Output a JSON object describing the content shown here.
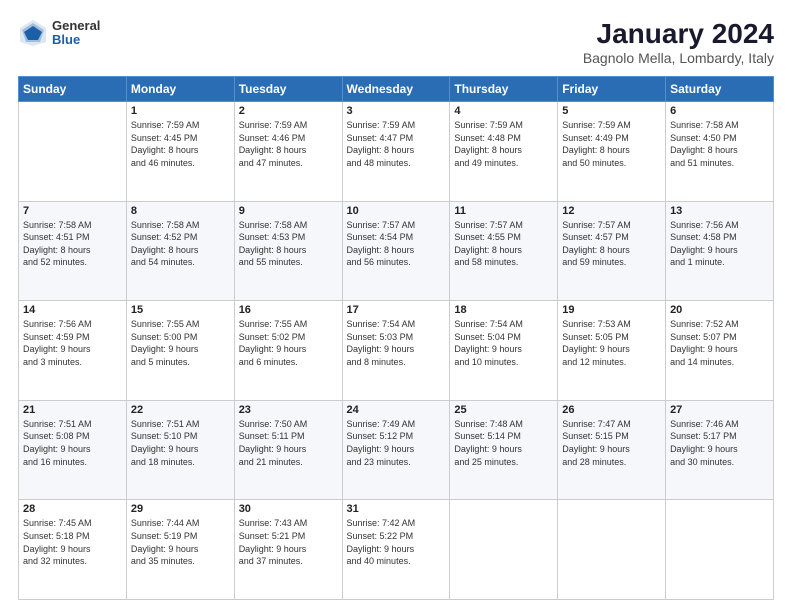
{
  "header": {
    "logo": {
      "general": "General",
      "blue": "Blue"
    },
    "title": "January 2024",
    "subtitle": "Bagnolo Mella, Lombardy, Italy"
  },
  "calendar": {
    "days_of_week": [
      "Sunday",
      "Monday",
      "Tuesday",
      "Wednesday",
      "Thursday",
      "Friday",
      "Saturday"
    ],
    "weeks": [
      [
        {
          "day": "",
          "info": ""
        },
        {
          "day": "1",
          "info": "Sunrise: 7:59 AM\nSunset: 4:45 PM\nDaylight: 8 hours\nand 46 minutes."
        },
        {
          "day": "2",
          "info": "Sunrise: 7:59 AM\nSunset: 4:46 PM\nDaylight: 8 hours\nand 47 minutes."
        },
        {
          "day": "3",
          "info": "Sunrise: 7:59 AM\nSunset: 4:47 PM\nDaylight: 8 hours\nand 48 minutes."
        },
        {
          "day": "4",
          "info": "Sunrise: 7:59 AM\nSunset: 4:48 PM\nDaylight: 8 hours\nand 49 minutes."
        },
        {
          "day": "5",
          "info": "Sunrise: 7:59 AM\nSunset: 4:49 PM\nDaylight: 8 hours\nand 50 minutes."
        },
        {
          "day": "6",
          "info": "Sunrise: 7:58 AM\nSunset: 4:50 PM\nDaylight: 8 hours\nand 51 minutes."
        }
      ],
      [
        {
          "day": "7",
          "info": "Sunrise: 7:58 AM\nSunset: 4:51 PM\nDaylight: 8 hours\nand 52 minutes."
        },
        {
          "day": "8",
          "info": "Sunrise: 7:58 AM\nSunset: 4:52 PM\nDaylight: 8 hours\nand 54 minutes."
        },
        {
          "day": "9",
          "info": "Sunrise: 7:58 AM\nSunset: 4:53 PM\nDaylight: 8 hours\nand 55 minutes."
        },
        {
          "day": "10",
          "info": "Sunrise: 7:57 AM\nSunset: 4:54 PM\nDaylight: 8 hours\nand 56 minutes."
        },
        {
          "day": "11",
          "info": "Sunrise: 7:57 AM\nSunset: 4:55 PM\nDaylight: 8 hours\nand 58 minutes."
        },
        {
          "day": "12",
          "info": "Sunrise: 7:57 AM\nSunset: 4:57 PM\nDaylight: 8 hours\nand 59 minutes."
        },
        {
          "day": "13",
          "info": "Sunrise: 7:56 AM\nSunset: 4:58 PM\nDaylight: 9 hours\nand 1 minute."
        }
      ],
      [
        {
          "day": "14",
          "info": "Sunrise: 7:56 AM\nSunset: 4:59 PM\nDaylight: 9 hours\nand 3 minutes."
        },
        {
          "day": "15",
          "info": "Sunrise: 7:55 AM\nSunset: 5:00 PM\nDaylight: 9 hours\nand 5 minutes."
        },
        {
          "day": "16",
          "info": "Sunrise: 7:55 AM\nSunset: 5:02 PM\nDaylight: 9 hours\nand 6 minutes."
        },
        {
          "day": "17",
          "info": "Sunrise: 7:54 AM\nSunset: 5:03 PM\nDaylight: 9 hours\nand 8 minutes."
        },
        {
          "day": "18",
          "info": "Sunrise: 7:54 AM\nSunset: 5:04 PM\nDaylight: 9 hours\nand 10 minutes."
        },
        {
          "day": "19",
          "info": "Sunrise: 7:53 AM\nSunset: 5:05 PM\nDaylight: 9 hours\nand 12 minutes."
        },
        {
          "day": "20",
          "info": "Sunrise: 7:52 AM\nSunset: 5:07 PM\nDaylight: 9 hours\nand 14 minutes."
        }
      ],
      [
        {
          "day": "21",
          "info": "Sunrise: 7:51 AM\nSunset: 5:08 PM\nDaylight: 9 hours\nand 16 minutes."
        },
        {
          "day": "22",
          "info": "Sunrise: 7:51 AM\nSunset: 5:10 PM\nDaylight: 9 hours\nand 18 minutes."
        },
        {
          "day": "23",
          "info": "Sunrise: 7:50 AM\nSunset: 5:11 PM\nDaylight: 9 hours\nand 21 minutes."
        },
        {
          "day": "24",
          "info": "Sunrise: 7:49 AM\nSunset: 5:12 PM\nDaylight: 9 hours\nand 23 minutes."
        },
        {
          "day": "25",
          "info": "Sunrise: 7:48 AM\nSunset: 5:14 PM\nDaylight: 9 hours\nand 25 minutes."
        },
        {
          "day": "26",
          "info": "Sunrise: 7:47 AM\nSunset: 5:15 PM\nDaylight: 9 hours\nand 28 minutes."
        },
        {
          "day": "27",
          "info": "Sunrise: 7:46 AM\nSunset: 5:17 PM\nDaylight: 9 hours\nand 30 minutes."
        }
      ],
      [
        {
          "day": "28",
          "info": "Sunrise: 7:45 AM\nSunset: 5:18 PM\nDaylight: 9 hours\nand 32 minutes."
        },
        {
          "day": "29",
          "info": "Sunrise: 7:44 AM\nSunset: 5:19 PM\nDaylight: 9 hours\nand 35 minutes."
        },
        {
          "day": "30",
          "info": "Sunrise: 7:43 AM\nSunset: 5:21 PM\nDaylight: 9 hours\nand 37 minutes."
        },
        {
          "day": "31",
          "info": "Sunrise: 7:42 AM\nSunset: 5:22 PM\nDaylight: 9 hours\nand 40 minutes."
        },
        {
          "day": "",
          "info": ""
        },
        {
          "day": "",
          "info": ""
        },
        {
          "day": "",
          "info": ""
        }
      ]
    ]
  }
}
